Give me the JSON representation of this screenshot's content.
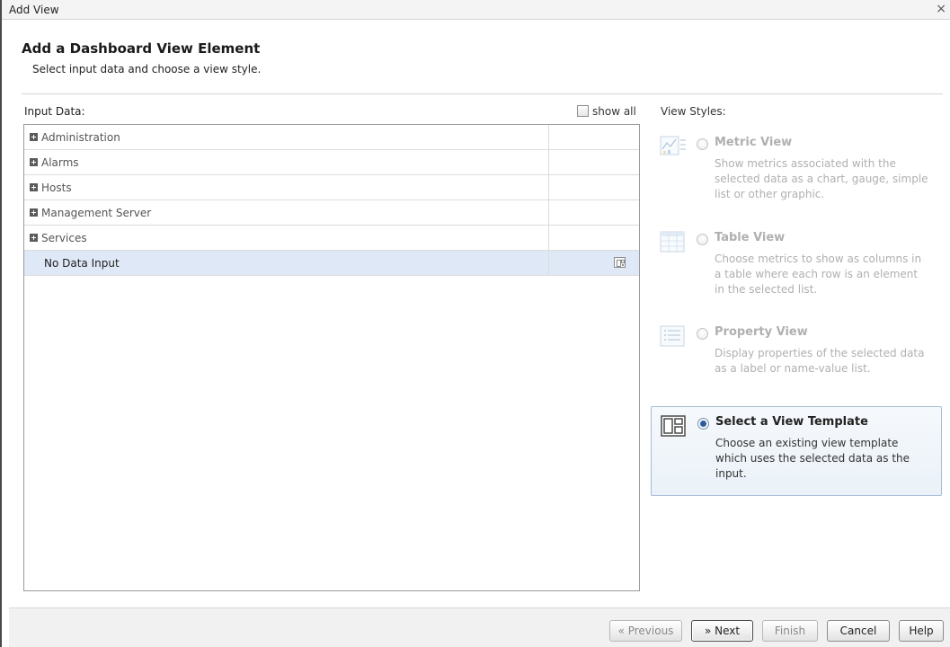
{
  "window": {
    "title": "Add View",
    "close_glyph": "×"
  },
  "header": {
    "title": "Add a Dashboard View Element",
    "subtitle": "Select input data and choose a view style."
  },
  "input_data": {
    "label": "Input Data:",
    "show_all_label": "show all",
    "show_all_checked": false,
    "rows": [
      {
        "label": "Administration",
        "expandable": true,
        "selected": false
      },
      {
        "label": "Alarms",
        "expandable": true,
        "selected": false
      },
      {
        "label": "Hosts",
        "expandable": true,
        "selected": false
      },
      {
        "label": "Management Server",
        "expandable": true,
        "selected": false
      },
      {
        "label": "Services",
        "expandable": true,
        "selected": false
      },
      {
        "label": "No Data Input",
        "expandable": false,
        "selected": true,
        "icon": "view-template-icon"
      }
    ]
  },
  "view_styles": {
    "label": "View Styles:",
    "items": [
      {
        "name": "Metric View",
        "description": "Show metrics associated with the selected data as a chart, gauge, simple list or other graphic.",
        "icon": "metric-chart-icon",
        "enabled": false,
        "selected": false
      },
      {
        "name": "Table View",
        "description": "Choose metrics to show as columns in a table where each row is an element in the selected list.",
        "icon": "table-icon",
        "enabled": false,
        "selected": false
      },
      {
        "name": "Property View",
        "description": "Display properties of the selected data as a label or name-value list.",
        "icon": "property-list-icon",
        "enabled": false,
        "selected": false
      },
      {
        "name": "Select a View Template",
        "description": "Choose an existing view template which uses the selected data as the input.",
        "icon": "view-template-icon",
        "enabled": true,
        "selected": true
      }
    ]
  },
  "footer": {
    "previous_label": "« Previous",
    "next_label": "» Next",
    "finish_label": "Finish",
    "cancel_label": "Cancel",
    "help_label": "Help"
  }
}
